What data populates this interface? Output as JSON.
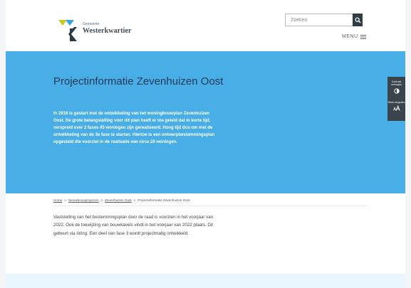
{
  "header": {
    "logo": {
      "small_text": "Gemeente",
      "name": "Westerkwartier"
    },
    "search": {
      "placeholder": "Zoeken"
    },
    "menu_label": "MENU"
  },
  "hero": {
    "title": "Projectinformatie Zevenhuizen Oost",
    "text": "In 2016 is gestart met de ontwikkeling van het woningbouwplan Zevenhuizen Oost. De grote belangstelling voor dit plan heeft er toe geleid dat in korte tijd, verspreid over 2 fases 45 woningen zijn gerealiseerd. Hoog tijd dus om met de ontwikkeling van de 3e fase te starten. Hiertoe is een ontwerpbestemmingsplan opgesteld die voorziet in de realisatie van circa 20 woningen."
  },
  "accessibility": {
    "contrast_label": "Contrast verhogen",
    "text_label": "Tekst vergroten"
  },
  "breadcrumb": {
    "items": [
      "Home",
      "Nieuwbouwprojecten",
      "Zevenhuizen Oost",
      "Projectinformatie Zevenhuizen Oost"
    ],
    "separator": ">"
  },
  "content": {
    "paragraph": "Vaststelling van het bestemmingsplan door de raad is voorzien in het voorjaar van 2022. Ook de toewijzing van bouwkavels vindt in het voorjaar van 2022 plaats. Dit gebeurt via loting. Een deel van fase 3 wordt projectmatig ontwikkeld."
  },
  "colors": {
    "hero_bg": "#4aaee6",
    "hero_title": "#1f3a56",
    "search_button": "#2f3c44",
    "logo_yellow": "#c7c923",
    "logo_blue": "#2fa5dc",
    "logo_dark": "#2e3a44"
  }
}
